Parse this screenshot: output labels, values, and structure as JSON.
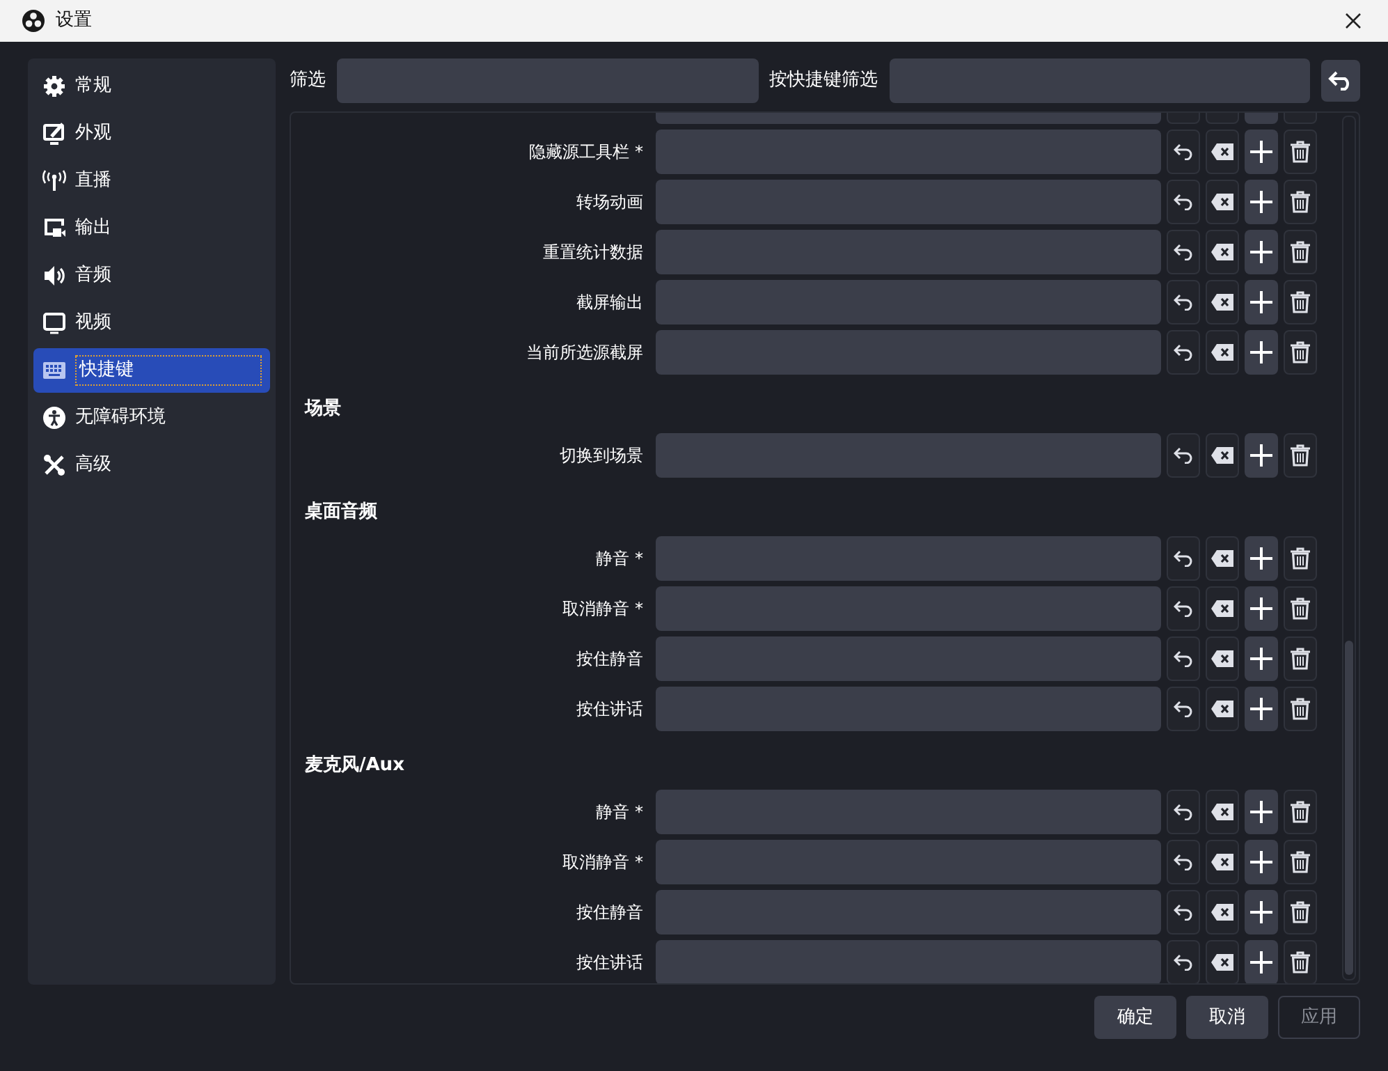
{
  "window": {
    "title": "设置"
  },
  "sidebar": {
    "items": [
      {
        "label": "常规",
        "selected": false
      },
      {
        "label": "外观",
        "selected": false
      },
      {
        "label": "直播",
        "selected": false
      },
      {
        "label": "输出",
        "selected": false
      },
      {
        "label": "音频",
        "selected": false
      },
      {
        "label": "视频",
        "selected": false
      },
      {
        "label": "快捷键",
        "selected": true
      },
      {
        "label": "无障碍环境",
        "selected": false
      },
      {
        "label": "高级",
        "selected": false
      }
    ]
  },
  "filters": [
    {
      "label": "筛选"
    },
    {
      "label": "按快捷键筛选"
    }
  ],
  "sections": [
    {
      "rows": [
        {
          "label": "隐藏源工具栏 *"
        },
        {
          "label": "转场动画"
        },
        {
          "label": "重置统计数据"
        },
        {
          "label": "截屏输出"
        },
        {
          "label": "当前所选源截屏"
        }
      ]
    },
    {
      "heading": "场景",
      "rows": [
        {
          "label": "切换到场景"
        }
      ]
    },
    {
      "heading": "桌面音频",
      "rows": [
        {
          "label": "静音 *"
        },
        {
          "label": "取消静音 *"
        },
        {
          "label": "按住静音"
        },
        {
          "label": "按住讲话"
        }
      ]
    },
    {
      "heading": "麦克风/Aux",
      "rows": [
        {
          "label": "静音 *"
        },
        {
          "label": "取消静音 *"
        },
        {
          "label": "按住静音"
        },
        {
          "label": "按住讲话"
        }
      ]
    }
  ],
  "buttons": [
    {
      "label": "确定",
      "disabled": false
    },
    {
      "label": "取消",
      "disabled": false
    },
    {
      "label": "应用",
      "disabled": true
    }
  ]
}
